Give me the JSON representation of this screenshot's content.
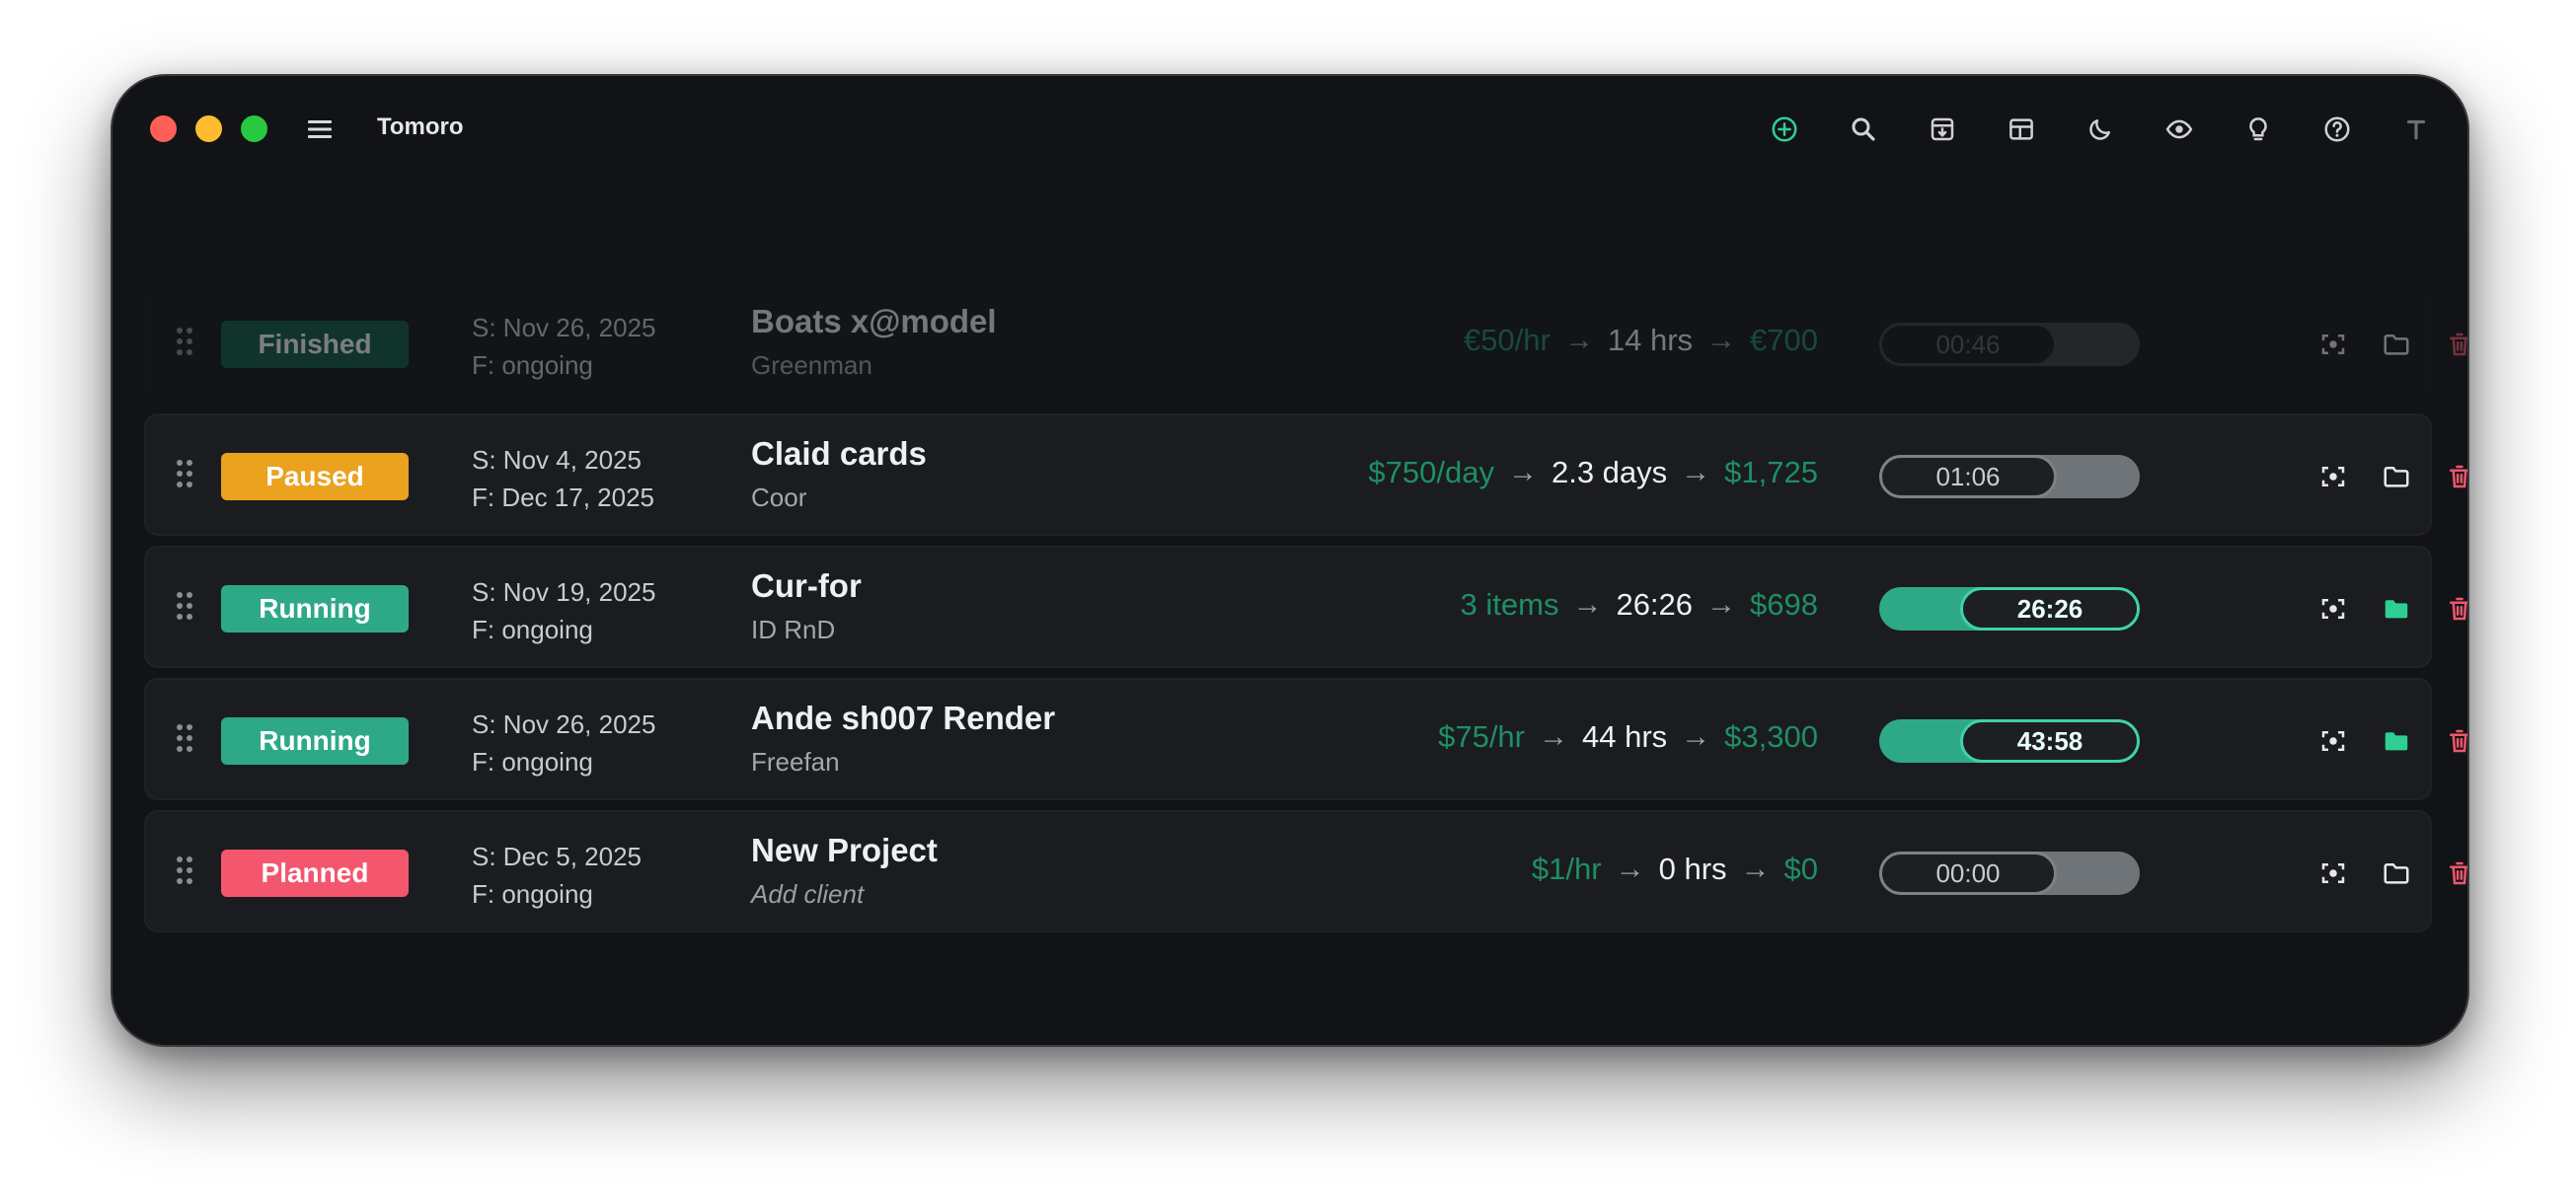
{
  "app": {
    "title": "Tomoro"
  },
  "toolbar": {
    "icons": [
      "add-circle-icon",
      "search-icon",
      "archive-icon",
      "layout-icon",
      "moon-icon",
      "eye-icon",
      "lightbulb-icon",
      "help-icon",
      "text-icon"
    ]
  },
  "colors": {
    "finished": "#0e5c46",
    "paused": "#eaa21f",
    "running": "#2ea987",
    "planned": "#f4566e",
    "money_green": "#1f8f64",
    "delete_red": "#f0566c"
  },
  "projects": [
    {
      "status": "Finished",
      "start": "S: Nov 26, 2025",
      "finish": "F: ongoing",
      "name": "Boats x@model",
      "client": "Greenman",
      "rate": "€50/hr",
      "quantity": "14 hrs",
      "total": "€700",
      "timer": "00:46",
      "folder_filled": false,
      "expanded": true
    },
    {
      "status": "Paused",
      "start": "S: Nov 4, 2025",
      "finish": "F: Dec 17, 2025",
      "name": "Claid cards",
      "client": "Coor",
      "rate": "$750/day",
      "quantity": "2.3 days",
      "total": "$1,725",
      "timer": "01:06",
      "folder_filled": false,
      "expanded": false
    },
    {
      "status": "Running",
      "start": "S: Nov 19, 2025",
      "finish": "F: ongoing",
      "name": "Cur-for",
      "client": "ID RnD",
      "rate": "3 items",
      "quantity": "26:26",
      "total": "$698",
      "timer": "26:26",
      "folder_filled": true,
      "expanded": false
    },
    {
      "status": "Running",
      "start": "S: Nov 26, 2025",
      "finish": "F: ongoing",
      "name": "Ande sh007 Render",
      "client": "Freefan",
      "rate": "$75/hr",
      "quantity": "44 hrs",
      "total": "$3,300",
      "timer": "43:58",
      "folder_filled": true,
      "expanded": true
    },
    {
      "status": "Planned",
      "start": "S: Dec 5, 2025",
      "finish": "F: ongoing",
      "name": "New Project",
      "client": "Add client",
      "rate": "$1/hr",
      "quantity": "0 hrs",
      "total": "$0",
      "timer": "00:00",
      "folder_filled": false,
      "expanded": false
    }
  ]
}
